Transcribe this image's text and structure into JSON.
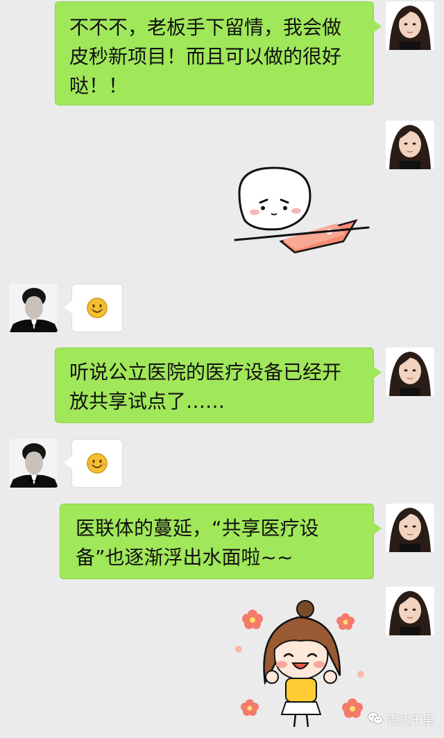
{
  "messages": [
    {
      "side": "right",
      "type": "text",
      "text": "不不不，老板手下留情，我会做皮秒新项目！而且可以做的很好哒！！"
    },
    {
      "side": "right",
      "type": "sticker",
      "sticker": "typing-laptop-sticker"
    },
    {
      "side": "left",
      "type": "emoji",
      "emoji": "🙂"
    },
    {
      "side": "right",
      "type": "text",
      "text": "听说公立医院的医疗设备已经开放共享试点了……"
    },
    {
      "side": "left",
      "type": "emoji",
      "emoji": "🙂"
    },
    {
      "side": "right",
      "type": "text",
      "text": "医联体的蔓延，“共享医疗设备”也逐渐浮出水面啦~~"
    },
    {
      "side": "right",
      "type": "sticker",
      "sticker": "flower-girl-sticker"
    }
  ],
  "watermark": {
    "text": "百达千里",
    "icon": "wechat-official-account-icon"
  },
  "colors": {
    "background": "#ebebeb",
    "green_bubble": "#a0e75a",
    "white_bubble": "#ffffff"
  }
}
